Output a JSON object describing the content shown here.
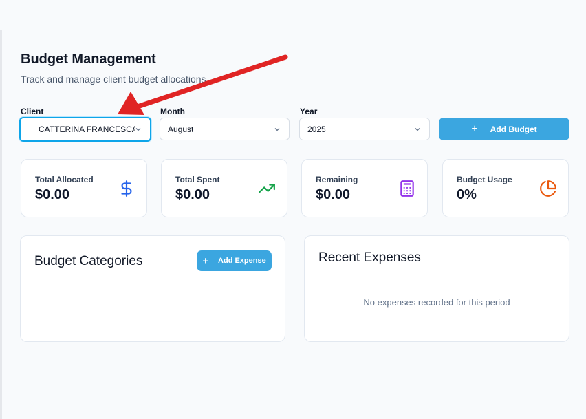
{
  "header": {
    "title": "Budget Management",
    "subtitle": "Track and manage client budget allocations"
  },
  "filters": {
    "client": {
      "label": "Client",
      "value": "CATTERINA FRANCESCA..."
    },
    "month": {
      "label": "Month",
      "value": "August"
    },
    "year": {
      "label": "Year",
      "value": "2025"
    }
  },
  "actions": {
    "add_budget_label": "Add Budget",
    "add_expense_label": "Add Expense",
    "plus_glyph": "+"
  },
  "stats": [
    {
      "label": "Total Allocated",
      "value": "$0.00",
      "icon": "dollar-icon",
      "color": "#2563eb"
    },
    {
      "label": "Total Spent",
      "value": "$0.00",
      "icon": "trending-up-icon",
      "color": "#16a34a"
    },
    {
      "label": "Remaining",
      "value": "$0.00",
      "icon": "calculator-icon",
      "color": "#9333ea"
    },
    {
      "label": "Budget Usage",
      "value": "0%",
      "icon": "pie-chart-icon",
      "color": "#ea580c"
    }
  ],
  "panels": {
    "categories": {
      "title": "Budget Categories"
    },
    "expenses": {
      "title": "Recent Expenses",
      "empty_text": "No expenses recorded for this period"
    }
  },
  "colors": {
    "accent": "#3ba6e0",
    "focus_ring": "#0ea5e9",
    "annotation_arrow": "#e02424"
  }
}
